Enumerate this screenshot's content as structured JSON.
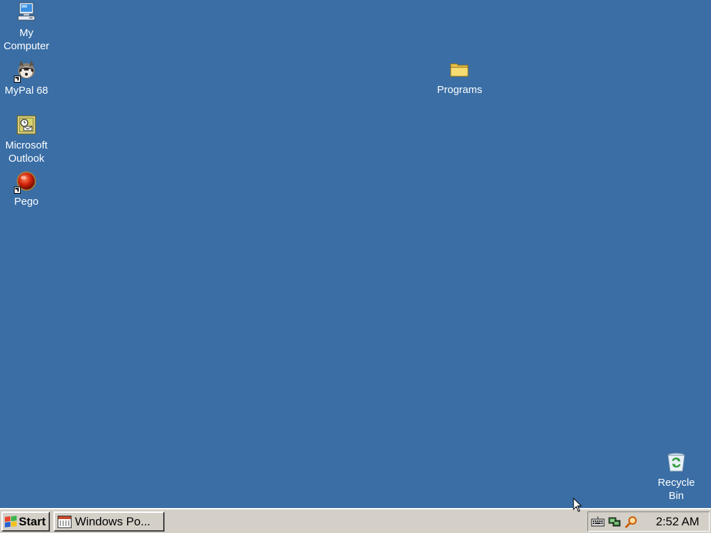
{
  "desktop": {
    "background_color": "#3a6ea5",
    "icons": [
      {
        "label": "My\nComputer",
        "icon": "my-computer-icon"
      },
      {
        "label": "MyPal 68",
        "icon": "raccoon-icon",
        "shortcut": true
      },
      {
        "label": "Microsoft\nOutlook",
        "icon": "outlook-icon"
      },
      {
        "label": "Pego",
        "icon": "pego-icon",
        "shortcut": true
      },
      {
        "label": "Programs",
        "icon": "folder-icon"
      },
      {
        "label": "Recycle\nBin",
        "icon": "recycle-bin-icon"
      }
    ]
  },
  "taskbar": {
    "start_label": "Start",
    "task_button_label": "Windows Po...",
    "tray_icons": [
      "keyboard-icon",
      "network-icon",
      "search-icon"
    ],
    "clock": "2:52 AM"
  }
}
